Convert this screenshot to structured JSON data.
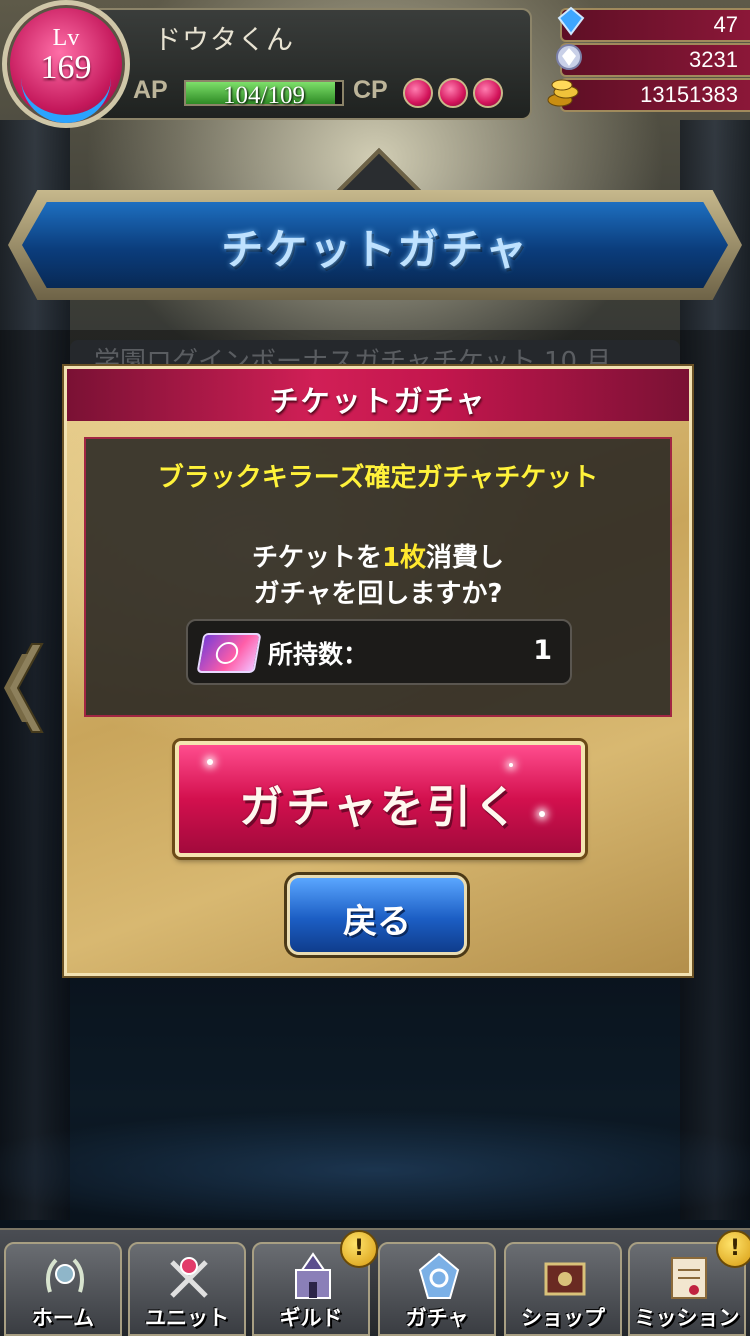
{
  "status": {
    "level_label": "Lv",
    "level": "169",
    "player_name": "ドウタくん",
    "ap_label": "AP",
    "ap_text": "104/109",
    "ap_fraction": 0.954,
    "cp_label": "CP",
    "cp_points": 3,
    "currencies": [
      {
        "icon": "blue-crystal-icon",
        "value": "47"
      },
      {
        "icon": "white-gem-icon",
        "value": "3231"
      },
      {
        "icon": "gold-coins-icon",
        "value": "13151383"
      }
    ]
  },
  "banner": {
    "title": "チケットガチャ",
    "behind_text": "学園ログインボーナスガチャチケット 10 月"
  },
  "dialog": {
    "title": "チケットガチャ",
    "ticket_name": "ブラックキラーズ確定ガチャチケット",
    "confirm_prefix": "チケットを",
    "confirm_count": "1枚",
    "confirm_suffix": "消費し",
    "confirm_line2": "ガチャを回しますか?",
    "owned_label": "所持数：",
    "owned_value": "1",
    "draw_label": "ガチャを引く",
    "back_label": "戻る"
  },
  "nav": [
    {
      "id": "home",
      "label": "ホーム",
      "icon": "home-wreath-icon",
      "badge": ""
    },
    {
      "id": "unit",
      "label": "ユニット",
      "icon": "unit-swords-icon",
      "badge": ""
    },
    {
      "id": "guild",
      "label": "ギルド",
      "icon": "guild-castle-icon",
      "badge": "!"
    },
    {
      "id": "gacha",
      "label": "ガチャ",
      "icon": "gacha-crystal-icon",
      "badge": ""
    },
    {
      "id": "shop",
      "label": "ショップ",
      "icon": "shop-chest-icon",
      "badge": ""
    },
    {
      "id": "mission",
      "label": "ミッション",
      "icon": "mission-scroll-icon",
      "badge": "!"
    }
  ],
  "colors": {
    "accent_red": "#d3104e",
    "accent_blue": "#1c5ec4",
    "highlight_yellow": "#fff23a",
    "parchment": "#d8b871"
  }
}
